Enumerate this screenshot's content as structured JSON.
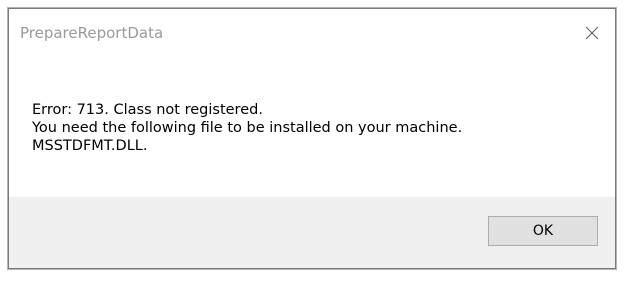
{
  "window": {
    "title": "PrepareReportData",
    "close_icon": "close-icon"
  },
  "message": {
    "lines": [
      "Error: 713. Class not registered.",
      "You need the following file to be installed on your machine.",
      "MSSTDFMT.DLL."
    ]
  },
  "buttons": {
    "ok_label": "OK"
  },
  "colors": {
    "title_text": "#9a9a9a",
    "footer_bg": "#f0f0f0",
    "button_bg": "#e1e1e1",
    "button_border": "#adadad"
  }
}
